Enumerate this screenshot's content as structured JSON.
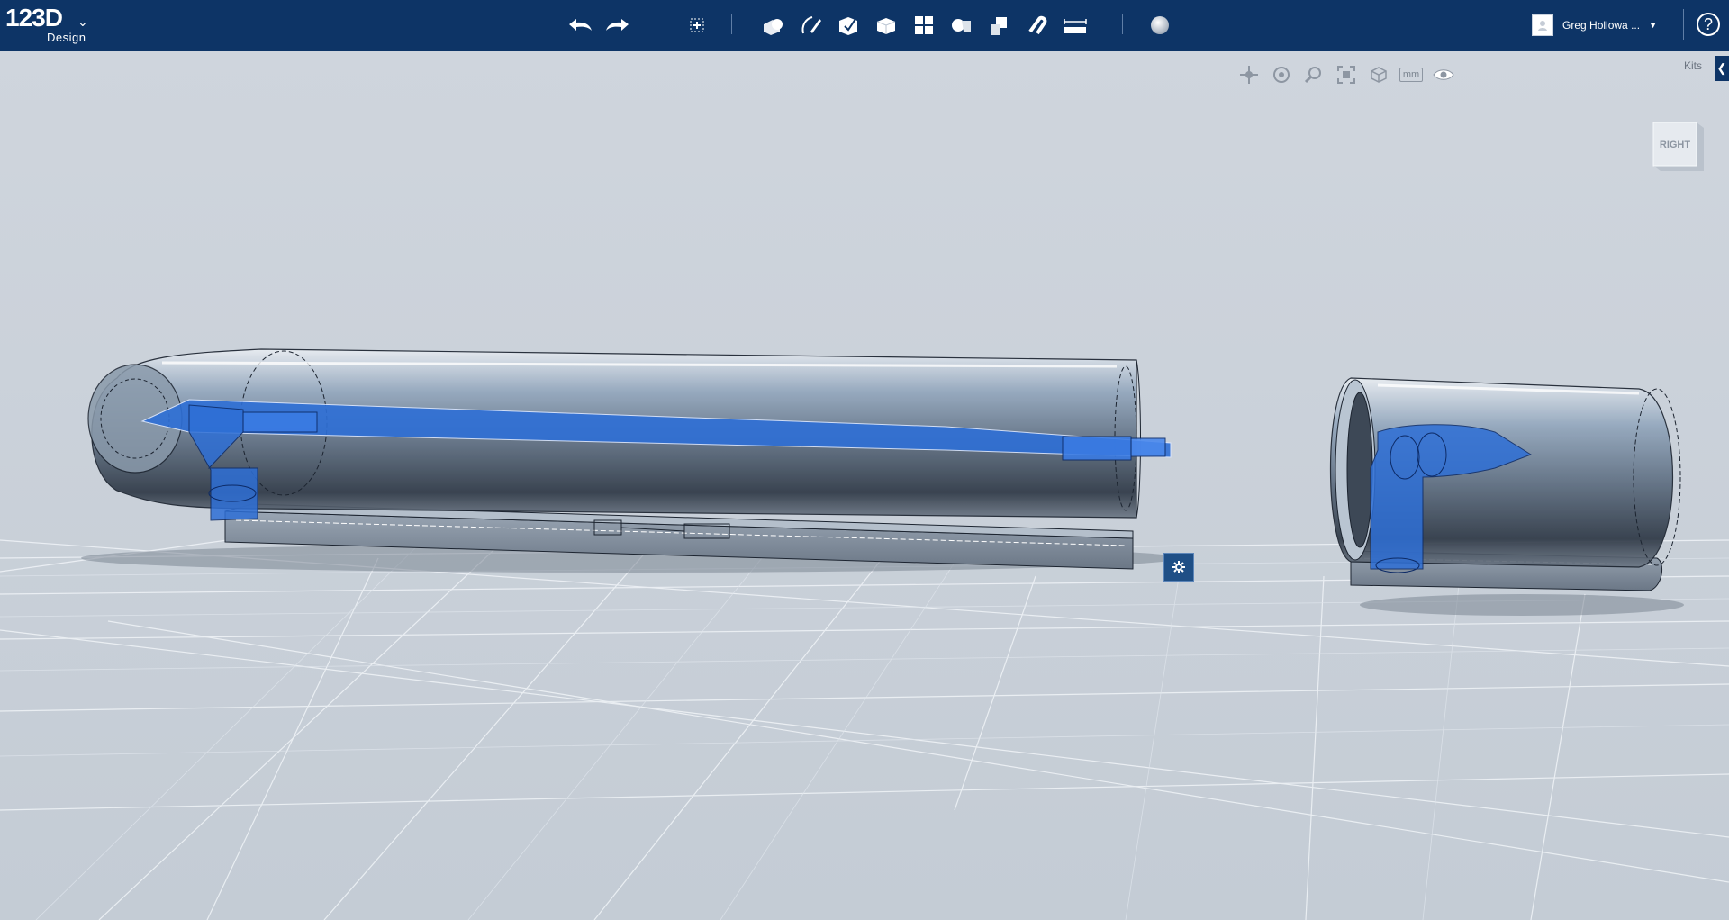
{
  "app": {
    "logo_main": "123D",
    "logo_sub": "Design"
  },
  "toolbar": {
    "undo_icon": "undo-arrow-icon",
    "redo_icon": "redo-arrow-icon",
    "tools": [
      "transform-icon",
      "primitives-icon",
      "sketch-icon",
      "construct-icon",
      "modify-icon",
      "pattern-icon",
      "grouping-icon",
      "combine-icon",
      "snap-icon",
      "measure-icon",
      "material-icon"
    ]
  },
  "user": {
    "name": "Greg Hollowa ..."
  },
  "help": {
    "label": "?"
  },
  "navigation": {
    "units_label": "mm",
    "tools": [
      "pan-icon",
      "orbit-icon",
      "zoom-icon",
      "fit-icon",
      "views-icon",
      "units-icon",
      "visibility-icon"
    ]
  },
  "kits": {
    "label": "Kits"
  },
  "viewcube": {
    "face_label": "RIGHT"
  },
  "colors": {
    "topbar": "#0d3466",
    "viewport": "#c9d0d8",
    "selection_blue": "#2e6fd6"
  }
}
